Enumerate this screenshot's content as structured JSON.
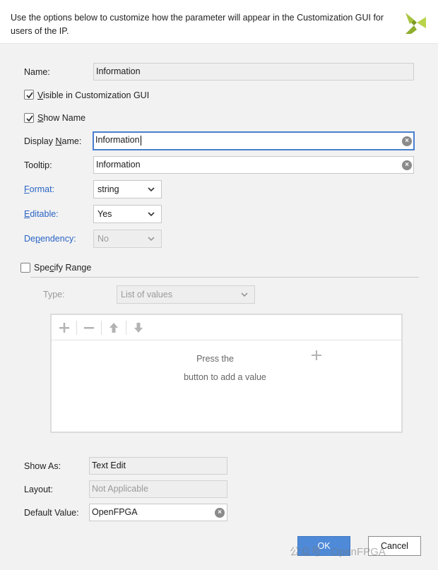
{
  "header": {
    "description": "Use the options below to customize how the parameter will appear in the Customization GUI for users of the IP."
  },
  "form": {
    "name": {
      "label": "Name:",
      "value": "Information"
    },
    "visible_in_gui": {
      "label_pre": "",
      "label_mnemonic": "V",
      "label_post": "isible in Customization GUI",
      "checked": true
    },
    "show_name": {
      "label_pre": "",
      "label_mnemonic": "S",
      "label_post": "how Name",
      "checked": true
    },
    "display_name": {
      "label_pre": "Display ",
      "label_mnemonic": "N",
      "label_post": "ame:",
      "value": "Information"
    },
    "tooltip": {
      "label": "Tooltip:",
      "value": "Information"
    },
    "format": {
      "label_pre": "",
      "label_mnemonic": "F",
      "label_post": "ormat:",
      "value": "string"
    },
    "editable": {
      "label_pre": "",
      "label_mnemonic": "E",
      "label_post": "ditable:",
      "value": "Yes"
    },
    "dependency": {
      "label_pre": "De",
      "label_mnemonic": "p",
      "label_post": "endency:",
      "value": "No"
    },
    "specify_range": {
      "label_pre": "Spe",
      "label_mnemonic": "c",
      "label_post": "ify Range",
      "checked": false
    }
  },
  "range": {
    "type_label": "Type:",
    "type_value": "List of values",
    "empty_line1": "Press the",
    "empty_line2": "button to add a value",
    "toolbar_icons": [
      "plus-icon",
      "minus-icon",
      "arrow-up-icon",
      "arrow-down-icon"
    ]
  },
  "bottom": {
    "show_as": {
      "label": "Show As:",
      "value": "Text Edit"
    },
    "layout": {
      "label": "Layout:",
      "value": "Not Applicable"
    },
    "default_value": {
      "label": "Default Value:",
      "value": "OpenFPGA"
    }
  },
  "buttons": {
    "ok": "OK",
    "cancel": "Cancel"
  },
  "watermark": "公众号 · OpenFPGA",
  "colors": {
    "accent": "#4f8ad8",
    "link": "#2a64c4",
    "logo": "#a7c43a"
  }
}
